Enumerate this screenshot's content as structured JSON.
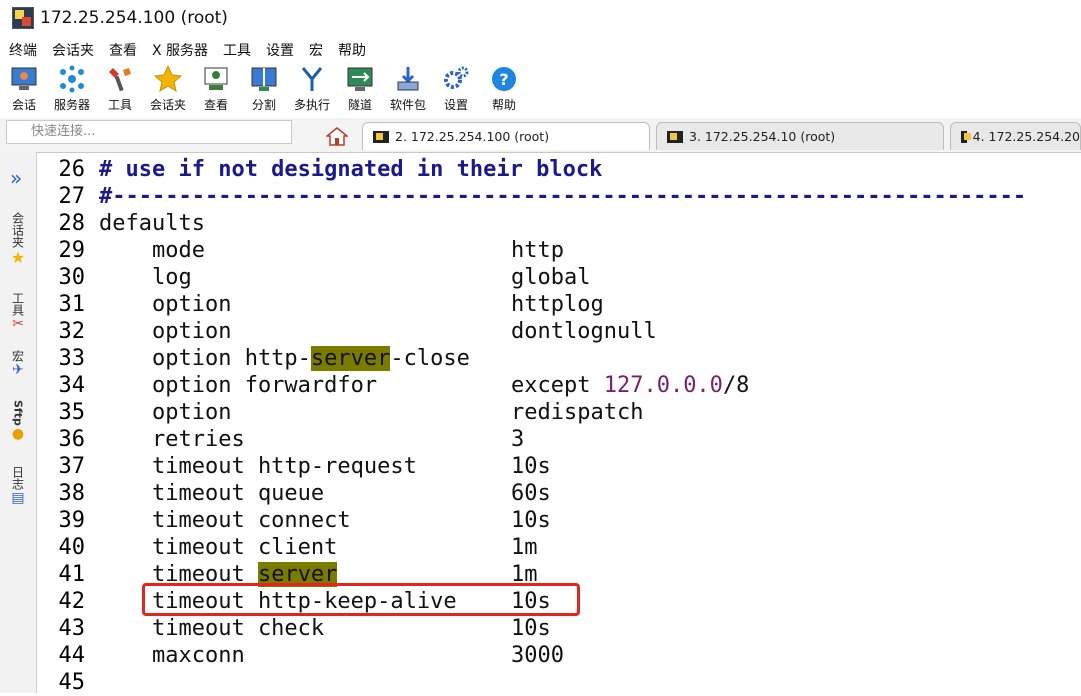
{
  "window": {
    "title": "172.25.254.100 (root)"
  },
  "menu": [
    "终端",
    "会话夹",
    "查看",
    "X 服务器",
    "工具",
    "设置",
    "宏",
    "帮助"
  ],
  "toolbar": [
    {
      "label": "会话",
      "icon": "session-icon"
    },
    {
      "label": "服务器",
      "icon": "servers-icon"
    },
    {
      "label": "工具",
      "icon": "tools-icon"
    },
    {
      "label": "会话夹",
      "icon": "star-icon"
    },
    {
      "label": "查看",
      "icon": "view-icon"
    },
    {
      "label": "分割",
      "icon": "split-icon"
    },
    {
      "label": "多执行",
      "icon": "multiexec-icon"
    },
    {
      "label": "隧道",
      "icon": "tunnel-icon"
    },
    {
      "label": "软件包",
      "icon": "packages-icon"
    },
    {
      "label": "设置",
      "icon": "gear-icon"
    },
    {
      "label": "帮助",
      "icon": "help-icon"
    }
  ],
  "quick_connect": {
    "placeholder": "快速连接..."
  },
  "tabs": [
    {
      "label": "2. 172.25.254.100 (root)",
      "active": true
    },
    {
      "label": "3. 172.25.254.10 (root)",
      "active": false
    },
    {
      "label": "4. 172.25.254.20",
      "active": false
    }
  ],
  "side_panel": [
    "会话夹",
    "工具",
    "宏",
    "Sftp",
    "日志"
  ],
  "terminal": {
    "lines": [
      {
        "n": "26",
        "text": "# use if not designated in their block"
      },
      {
        "n": "27",
        "text": "#---------------------------------------------------------------------"
      },
      {
        "n": "28",
        "text": "defaults"
      },
      {
        "n": "29",
        "key": "    mode",
        "val": "http"
      },
      {
        "n": "30",
        "key": "    log",
        "val": "global"
      },
      {
        "n": "31",
        "key": "    option",
        "val": "httplog"
      },
      {
        "n": "32",
        "key": "    option",
        "val": "dontlognull"
      },
      {
        "n": "33",
        "pre": "    option http-",
        "hl": "server",
        "post": "-close"
      },
      {
        "n": "34",
        "key": "    option forwardfor",
        "val": "except ",
        "num": "127.0.0.0",
        "tail": "/8"
      },
      {
        "n": "35",
        "key": "    option",
        "val": "redispatch"
      },
      {
        "n": "36",
        "key": "    retries",
        "val": "3"
      },
      {
        "n": "37",
        "key": "    timeout http-request",
        "val": "10s"
      },
      {
        "n": "38",
        "key": "    timeout queue",
        "val": "60s"
      },
      {
        "n": "39",
        "key": "    timeout connect",
        "val": "10s"
      },
      {
        "n": "40",
        "key": "    timeout client",
        "val": "1m"
      },
      {
        "n": "41",
        "pre": "    timeout ",
        "hl": "server",
        "val": "1m"
      },
      {
        "n": "42",
        "key": "    timeout http-keep-alive",
        "val": "10s"
      },
      {
        "n": "43",
        "key": "    timeout check",
        "val": "10s"
      },
      {
        "n": "44",
        "key": "    maxconn",
        "val": "3000"
      },
      {
        "n": "45",
        "text": ""
      }
    ]
  },
  "colors": {
    "highlight": "#7b7b00",
    "annotation_box": "#e3261c",
    "comment": "#1a1a8c",
    "number": "#7a1f6b"
  }
}
